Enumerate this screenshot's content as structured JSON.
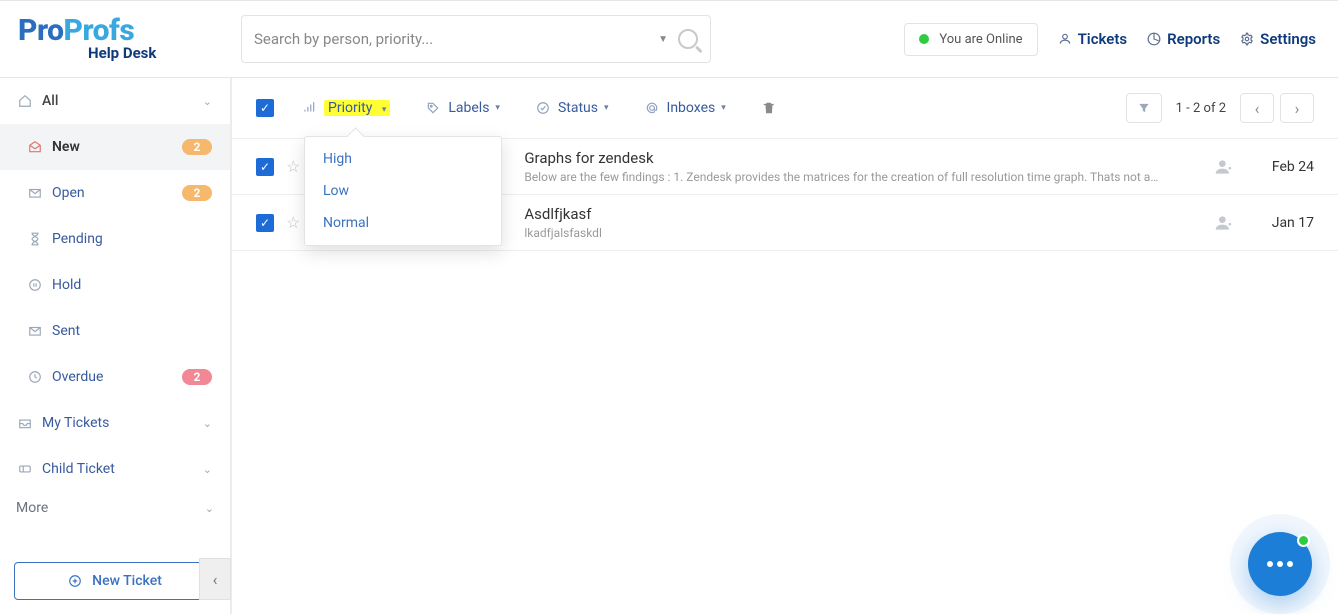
{
  "brand": {
    "p1": "Pro",
    "p2": "Profs",
    "sub": "Help Desk"
  },
  "search": {
    "placeholder": "Search by person, priority..."
  },
  "header": {
    "status_text": "You are Online",
    "nav": {
      "tickets": "Tickets",
      "reports": "Reports",
      "settings": "Settings"
    }
  },
  "sidebar": {
    "all": "All",
    "items": [
      {
        "label": "New",
        "badge": "2",
        "badge_class": "badge-orange",
        "active": true
      },
      {
        "label": "Open",
        "badge": "2",
        "badge_class": "badge-orange"
      },
      {
        "label": "Pending"
      },
      {
        "label": "Hold"
      },
      {
        "label": "Sent"
      },
      {
        "label": "Overdue",
        "badge": "2",
        "badge_class": "badge-red"
      }
    ],
    "my_tickets": "My Tickets",
    "child_ticket": "Child Ticket",
    "more": "More",
    "new_ticket": "New Ticket"
  },
  "toolbar": {
    "priority": "Priority",
    "labels": "Labels",
    "status": "Status",
    "inboxes": "Inboxes",
    "page_label": "1 - 2 of 2"
  },
  "priority_menu": {
    "high": "High",
    "low": "Low",
    "normal": "Normal"
  },
  "tickets": [
    {
      "title": "Graphs for zendesk",
      "snippet": "Below are the few findings : 1. Zendesk provides the matrices for the creation of full resolution time graph. Thats not a…",
      "date": "Feb 24"
    },
    {
      "title": "Asdlfjkasf",
      "snippet": "lkadfjalsfaskdl",
      "date": "Jan 17"
    }
  ]
}
